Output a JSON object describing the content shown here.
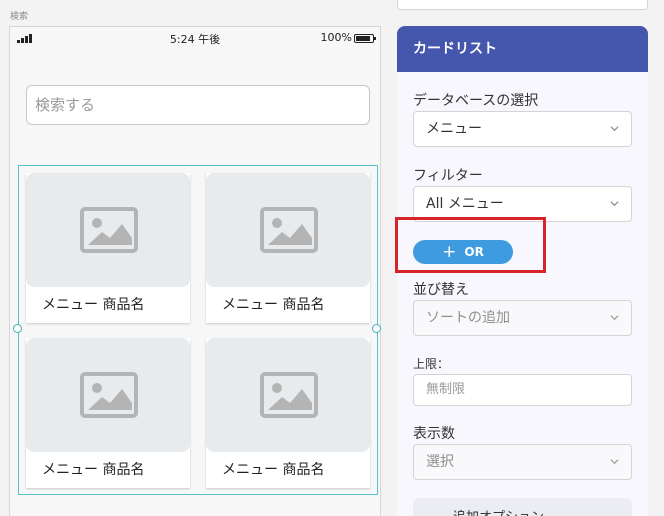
{
  "screen": {
    "name": "検索"
  },
  "status_bar": {
    "time": "5:24 午後",
    "battery": "100%"
  },
  "search": {
    "placeholder": "検索する"
  },
  "gallery": {
    "items": [
      {
        "title": "メニュー 商品名"
      },
      {
        "title": "メニュー 商品名"
      },
      {
        "title": "メニュー 商品名"
      },
      {
        "title": "メニュー 商品名"
      }
    ]
  },
  "panel": {
    "title": "カードリスト",
    "database_label": "データベースの選択",
    "database_value": "メニュー",
    "filter_label": "フィルター",
    "filter_value": "All メニュー",
    "or_button_label": "OR",
    "sort_label": "並び替え",
    "sort_placeholder": "ソートの追加",
    "limit_label": "上限：",
    "limit_placeholder": "無制限",
    "display_count_label": "表示数",
    "display_count_placeholder": "選択",
    "more_options_label": "追加オプション"
  },
  "colors": {
    "header": "#4556ad",
    "or_button": "#3f9be0",
    "highlight": "#d9232a",
    "selection": "#5bc0cf"
  },
  "icons": [
    "signal-icon",
    "battery-icon",
    "image-placeholder-icon",
    "chevron-down-icon",
    "plus-icon"
  ]
}
